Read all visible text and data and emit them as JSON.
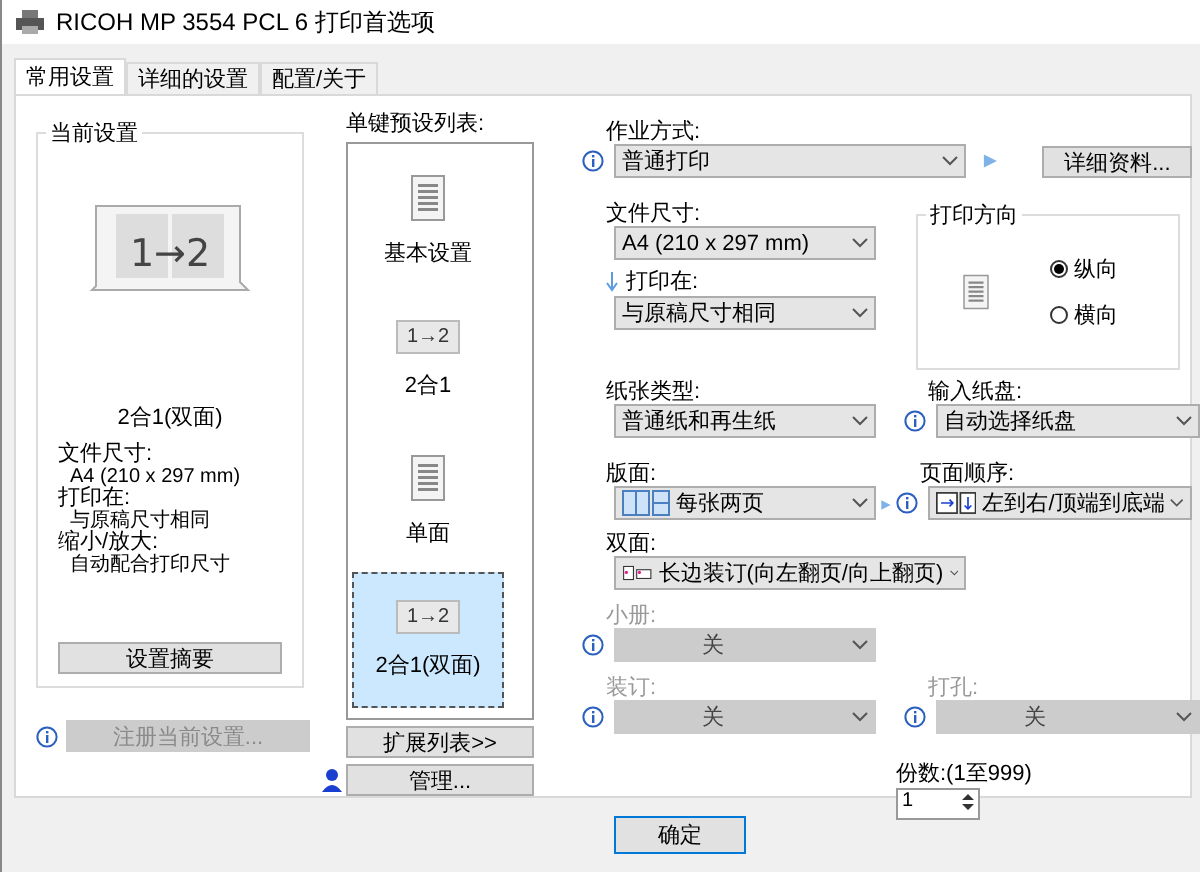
{
  "window": {
    "title": "RICOH MP 3554 PCL 6 打印首选项"
  },
  "tabs": [
    {
      "label": "常用设置",
      "selected": true
    },
    {
      "label": "详细的设置",
      "selected": false
    },
    {
      "label": "配置/关于",
      "selected": false
    }
  ],
  "current": {
    "title": "当前设置",
    "preview_text": "1→2",
    "caption": "2合1(双面)",
    "details": [
      {
        "label": "文件尺寸:",
        "value": "A4 (210 x 297 mm)"
      },
      {
        "label": "打印在:",
        "value": "与原稿尺寸相同"
      },
      {
        "label": "缩小/放大:",
        "value": "自动配合打印尺寸"
      }
    ],
    "summary_button": "设置摘要"
  },
  "register_button": {
    "label": "注册当前设置...",
    "disabled": true
  },
  "presets": {
    "title": "单键预设列表:",
    "items": [
      {
        "kind": "document",
        "label": "基本设置",
        "selected": false
      },
      {
        "kind": "combine",
        "icon_text": "1→2",
        "label": "2合1",
        "selected": false
      },
      {
        "kind": "document",
        "label": "单面",
        "selected": false
      },
      {
        "kind": "combine",
        "icon_text": "1→2",
        "label": "2合1(双面)",
        "selected": true
      }
    ]
  },
  "expand_button": "扩展列表>>",
  "manage_button": "管理...",
  "job": {
    "label": "作业方式:",
    "value": "普通打印",
    "details_button": "详细资料..."
  },
  "doc_size": {
    "label": "文件尺寸:",
    "value": "A4 (210 x 297 mm)"
  },
  "print_on": {
    "label": "打印在:",
    "value": "与原稿尺寸相同"
  },
  "orientation": {
    "title": "打印方向",
    "options": [
      {
        "label": "纵向",
        "selected": true
      },
      {
        "label": "横向",
        "selected": false
      }
    ]
  },
  "paper_type": {
    "label": "纸张类型:",
    "value": "普通纸和再生纸"
  },
  "input_tray": {
    "label": "输入纸盘:",
    "value": "自动选择纸盘"
  },
  "layout": {
    "label": "版面:",
    "value": "每张两页"
  },
  "page_order": {
    "label": "页面顺序:",
    "value": "左到右/顶端到底端"
  },
  "duplex": {
    "label": "双面:",
    "value": "长边装订(向左翻页/向上翻页)"
  },
  "booklet": {
    "label": "小册:",
    "value": "关",
    "disabled": true
  },
  "staple": {
    "label": "装订:",
    "value": "关",
    "disabled": true
  },
  "punch": {
    "label": "打孔:",
    "value": "关",
    "disabled": true
  },
  "copies": {
    "label": "份数:(1至999)",
    "value": "1"
  },
  "ok_button": "确定"
}
